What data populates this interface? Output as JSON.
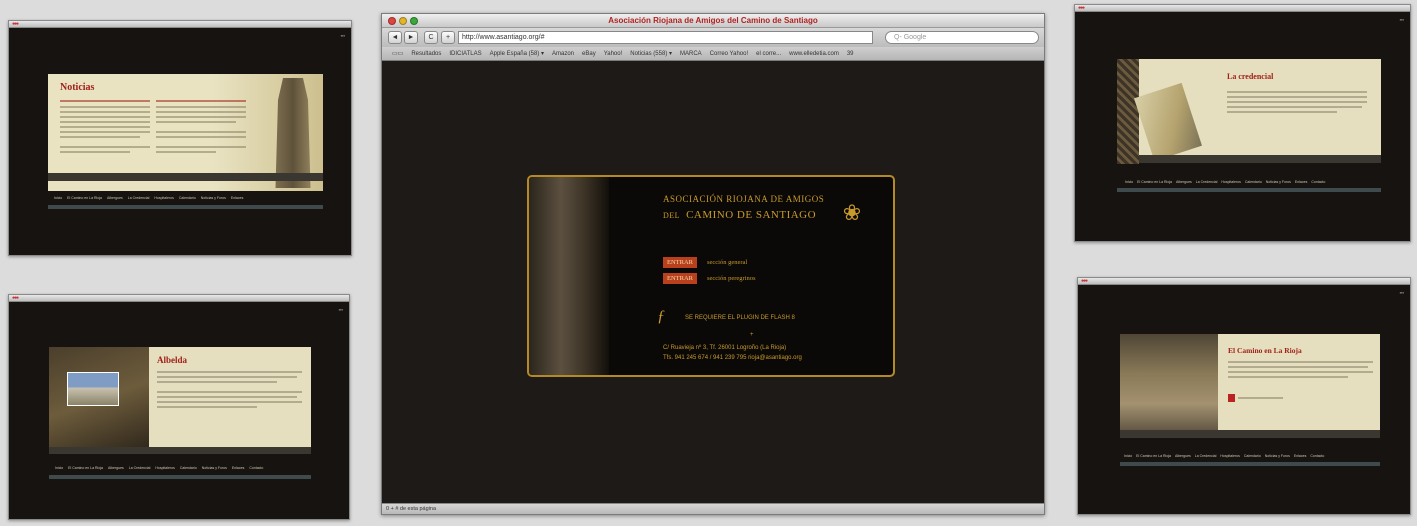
{
  "browser": {
    "title": "Asociación Riojana de Amigos del Camino de Santiago",
    "back": "◄",
    "forward": "►",
    "reload": "C",
    "add": "+",
    "url": "http://www.asantiago.org/#",
    "search_placeholder": "Q- Google",
    "bookmarks": [
      "Resultados",
      "IDICIATLAS",
      "Apple España (58) ▾",
      "Amazon",
      "eBay",
      "Yahoo!",
      "Noticias (558) ▾",
      "MARCA",
      "Correo Yahoo!",
      "el corre...",
      "www.elledetia.com",
      "39"
    ],
    "status": "0 + # de esta página",
    "colors": {
      "title": "#b22222",
      "red_light": "#e0443e",
      "yellow_light": "#e3b52a",
      "green_light": "#3aa83a"
    }
  },
  "splash": {
    "org_line1": "ASOCIACIÓN RIOJANA DE AMIGOS",
    "org_line2_prefix": "DEL",
    "org_line2": "CAMINO DE SANTIAGO",
    "entrar_1": "ENTRAR",
    "section_1": "sección general",
    "entrar_2": "ENTRAR",
    "section_2": "sección peregrinos",
    "flash_text": "SE REQUIERE EL PLUGIN DE FLASH 8",
    "separator": "+",
    "address_1": "C/ Ruavieja nº 3, Tf. 26001 Logroño (La Rioja)",
    "address_2": "Tfs. 941 245 674 / 941 239 795   rioja@asantiago.org",
    "colors": {
      "gold": "#c99a2c",
      "button": "#b8401c"
    }
  },
  "win_noticias": {
    "title": "Noticias",
    "nav": [
      "Inicio",
      "El Camino en La Rioja",
      "Albergues",
      "La Credencial",
      "Hospitaleros",
      "Calendario",
      "Noticias y Foros",
      "Enlaces",
      "Contacto"
    ]
  },
  "win_albelda": {
    "title": "Albelda",
    "nav": [
      "Inicio",
      "El Camino en La Rioja",
      "Albergues",
      "La Credencial",
      "Hospitaleros",
      "Calendario",
      "Noticias y Foros",
      "Enlaces",
      "Contacto"
    ]
  },
  "win_credencial": {
    "title": "La credencial",
    "nav": [
      "Inicio",
      "El Camino en La Rioja",
      "Albergues",
      "La Credencial",
      "Hospitaleros",
      "Calendario",
      "Noticias y Foros",
      "Enlaces",
      "Contacto"
    ]
  },
  "win_camino": {
    "title": "El Camino en La Rioja",
    "nav": [
      "Inicio",
      "El Camino en La Rioja",
      "Albergues",
      "La Credencial",
      "Hospitaleros",
      "Calendario",
      "Noticias y Foros",
      "Enlaces",
      "Contacto"
    ]
  }
}
